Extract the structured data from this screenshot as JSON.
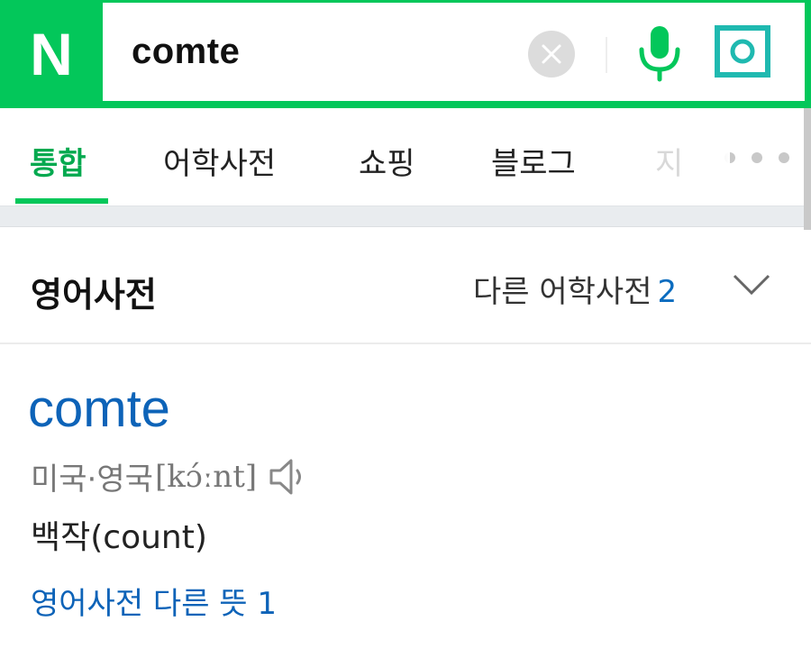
{
  "search": {
    "logo": "N",
    "query": "comte",
    "icons": [
      "clear-icon",
      "microphone-icon",
      "lens-icon"
    ]
  },
  "tabs": [
    {
      "label": "통합",
      "active": true
    },
    {
      "label": "어학사전",
      "active": false
    },
    {
      "label": "쇼핑",
      "active": false
    },
    {
      "label": "블로그",
      "active": false
    },
    {
      "label": "지",
      "active": false
    }
  ],
  "section": {
    "title": "영어사전",
    "other_dicts_label": "다른 어학사전",
    "other_dicts_count": "2"
  },
  "entry": {
    "word": "comte",
    "pron_region": "미국·영국",
    "pron_ipa": "[kɔ́ːnt]",
    "meaning": "백작(count)",
    "more_link": "영어사전 다른 뜻 1"
  },
  "colors": {
    "brand_green": "#03c75a",
    "link_blue": "#0d63b8"
  }
}
